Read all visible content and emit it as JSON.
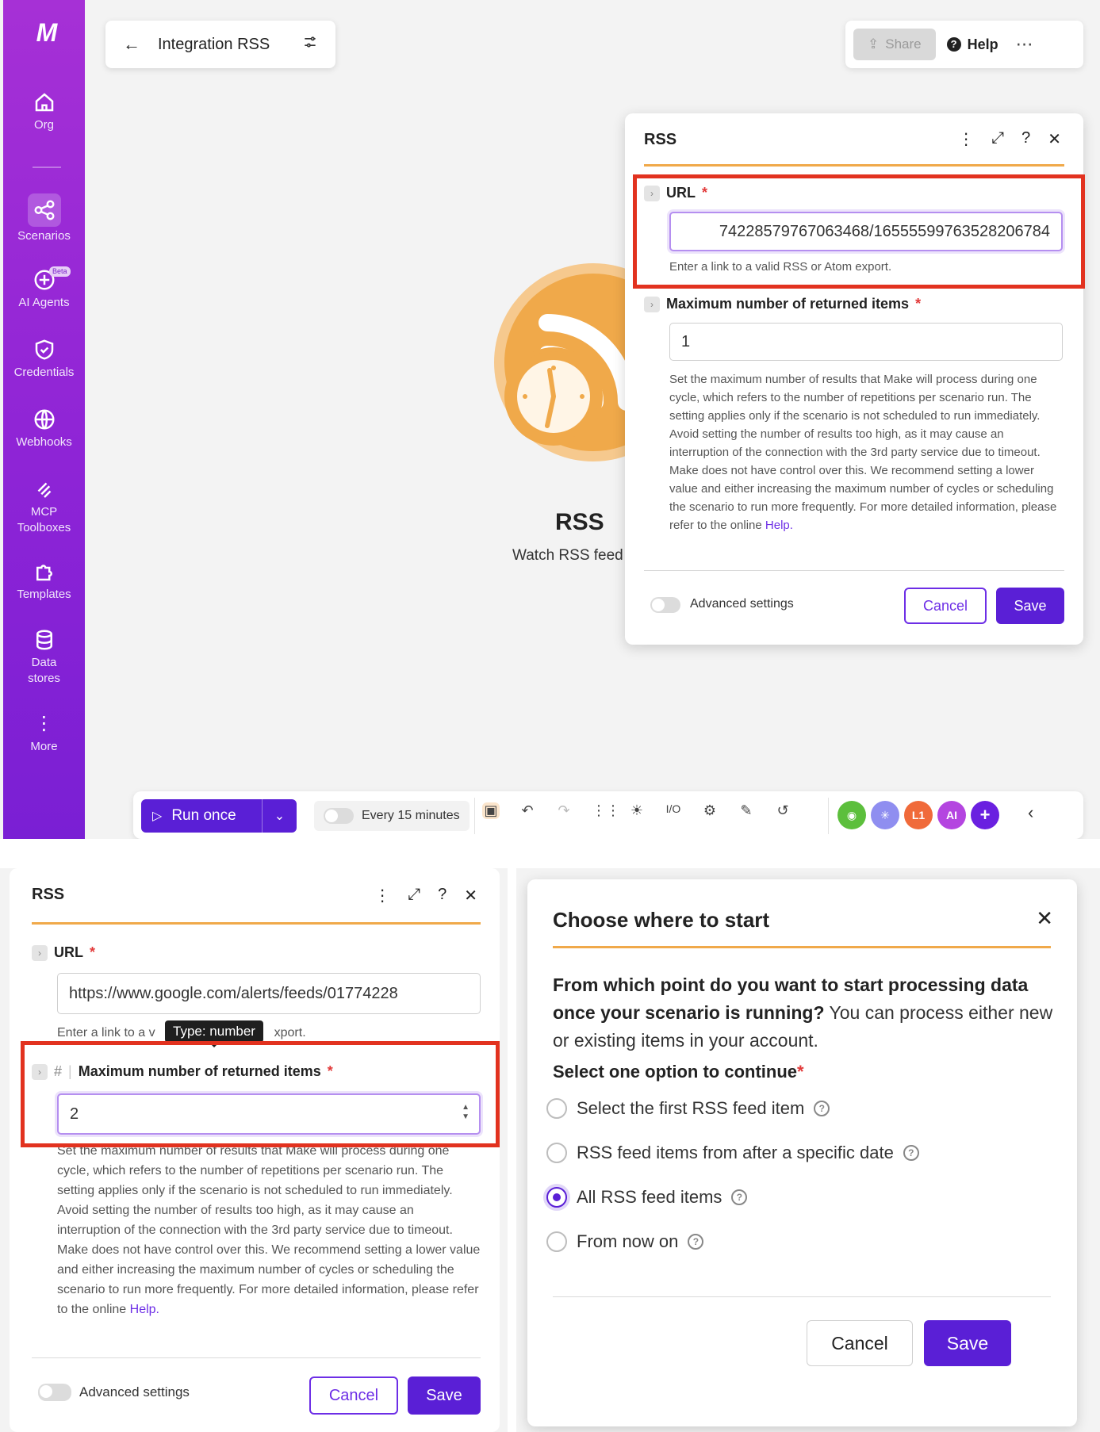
{
  "colors": {
    "purple": "#5a1fd6",
    "sidebar": "#9a28d6",
    "orange": "#f0a94a",
    "highlight_red": "#e2321f"
  },
  "sidebar": {
    "logo": "M",
    "items": [
      {
        "label": "Org",
        "icon": "home-icon"
      },
      {
        "label": "Scenarios",
        "icon": "share-nodes-icon"
      },
      {
        "label": "AI Agents",
        "icon": "ai-sparkle-icon",
        "badge": "Beta"
      },
      {
        "label": "Credentials",
        "icon": "shield-check-icon"
      },
      {
        "label": "Webhooks",
        "icon": "globe-icon"
      },
      {
        "label": "MCP Toolboxes",
        "icon": "mcp-icon"
      },
      {
        "label": "Templates",
        "icon": "puzzle-icon"
      },
      {
        "label": "Data stores",
        "icon": "database-icon"
      },
      {
        "label": "More",
        "icon": "vertical-dots-icon"
      }
    ]
  },
  "header": {
    "title": "Integration RSS",
    "share_label": "Share",
    "help_label": "Help"
  },
  "canvas": {
    "module_title": "RSS",
    "module_subtitle": "Watch RSS feed"
  },
  "rss_panel_top": {
    "title": "RSS",
    "url_label": "URL",
    "url_value": "7422857976706346­8/16555599763528206784",
    "url_hint": "Enter a link to a valid RSS or Atom export.",
    "max_label": "Maximum number of returned items",
    "max_value": "1",
    "max_hint": "Set the maximum number of results that Make will process during one cycle, which refers to the number of repetitions per scenario run. The setting applies only if the scenario is not scheduled to run immediately. Avoid setting the number of results too high, as it may cause an interruption of the connection with the 3rd party service due to timeout. Make does not have control over this. We recommend setting a lower value and either increasing the maximum number of cycles or scheduling the scenario to run more frequently. For more detailed information, please refer to the online",
    "help_link": "Help.",
    "advanced_label": "Advanced settings",
    "cancel_label": "Cancel",
    "save_label": "Save"
  },
  "toolbar": {
    "run_label": "Run once",
    "schedule_label": "Every 15 minutes",
    "apps": [
      "L1",
      "AI"
    ]
  },
  "rss_panel_bottom": {
    "title": "RSS",
    "url_label": "URL",
    "url_value": "https://www.google.com/alerts/feeds/01774228",
    "url_hint_start": "Enter a link to a v",
    "url_hint_end": "xport.",
    "tooltip": "Type: number",
    "hash": "#",
    "max_label": "Maximum number of returned items",
    "max_value": "2",
    "max_hint": "Set the maximum number of results that Make will process during one cycle, which refers to the number of repetitions per scenario run. The setting applies only if the scenario is not scheduled to run immediately. Avoid setting the number of results too high, as it may cause an interruption of the connection with the 3rd party service due to timeout. Make does not have control over this. We recommend setting a lower value and either increasing the maximum number of cycles or scheduling the scenario to run more frequently. For more detailed information, please refer to the online",
    "help_link": "Help.",
    "advanced_label": "Advanced settings",
    "cancel_label": "Cancel",
    "save_label": "Save"
  },
  "start_dialog": {
    "title": "Choose where to start",
    "question_bold": "From which point do you want to start processing data once your scenario is running?",
    "question_rest": " You can process either new or existing items in your account.",
    "select_label": "Select one option to continue",
    "options": [
      {
        "label": "Select the first RSS feed item",
        "selected": false
      },
      {
        "label": "RSS feed items from after a specific date",
        "selected": false
      },
      {
        "label": "All RSS feed items",
        "selected": true
      },
      {
        "label": "From now on",
        "selected": false
      }
    ],
    "cancel_label": "Cancel",
    "save_label": "Save"
  }
}
